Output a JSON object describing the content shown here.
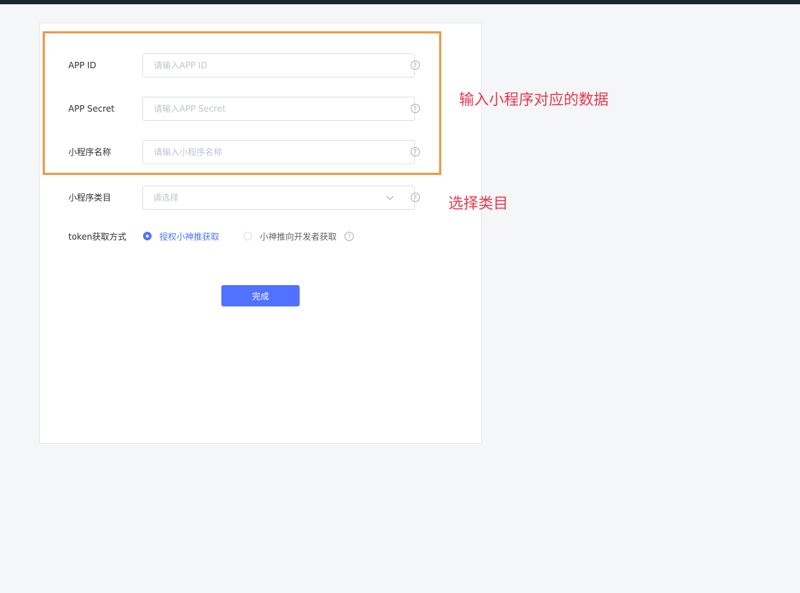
{
  "form": {
    "app_id": {
      "label": "APP ID",
      "placeholder": "请输入APP ID",
      "value": ""
    },
    "app_secret": {
      "label": "APP Secret",
      "placeholder": "请输入APP Secret",
      "value": ""
    },
    "mini_program_name": {
      "label": "小程序名称",
      "placeholder": "请输入小程序名称",
      "value": ""
    },
    "category": {
      "label": "小程序类目",
      "placeholder": "请选择",
      "value": ""
    },
    "token_method": {
      "label": "token获取方式",
      "options": [
        {
          "label": "授权小神推获取",
          "checked": true
        },
        {
          "label": "小神推向开发者获取",
          "checked": false
        }
      ]
    },
    "submit_label": "完成",
    "help_glyph": "?"
  },
  "annotations": {
    "input_data": "输入小程序对应的数据",
    "select_category": "选择类目"
  },
  "colors": {
    "primary": "#5171ff",
    "radio_selected_text": "#4f74ff",
    "highlight_border": "#f39745",
    "annotation_text": "#e8384d",
    "topbar": "#1f2433"
  },
  "icons": {
    "help": "question-circle-icon",
    "dropdown": "chevron-down-icon"
  }
}
